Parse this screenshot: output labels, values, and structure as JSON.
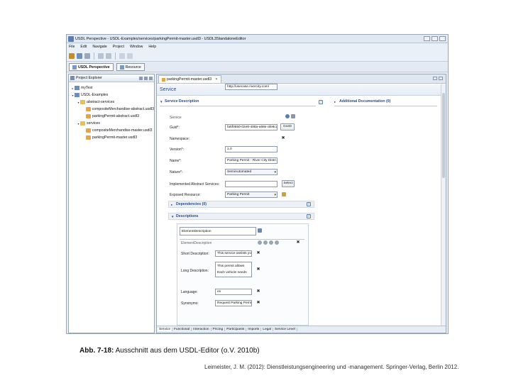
{
  "window": {
    "title": "USDL Perspective - USDL-Examples/services/parkingPermit-master.usdl3 - USDL3StandaloneEditor"
  },
  "menu": [
    "File",
    "Edit",
    "Navigate",
    "Project",
    "Window",
    "Help"
  ],
  "perspectives": {
    "active": "USDL Perspective",
    "other": "Resource"
  },
  "explorer": {
    "title": "Project Explorer",
    "tree": [
      {
        "label": "myTest",
        "level": 0,
        "kind": "project",
        "twisty": "▸"
      },
      {
        "label": "USDL-Examples",
        "level": 0,
        "kind": "project",
        "twisty": "▾"
      },
      {
        "label": "abstract-services",
        "level": 1,
        "kind": "folder",
        "twisty": "▾"
      },
      {
        "label": "compositeMerchandise-abstract.usdl3",
        "level": 2,
        "kind": "file",
        "twisty": ""
      },
      {
        "label": "parkingPermit-abstract.usdl3",
        "level": 2,
        "kind": "file",
        "twisty": ""
      },
      {
        "label": "services",
        "level": 1,
        "kind": "folder",
        "twisty": "▾"
      },
      {
        "label": "compositeMerchandise-master.usdl3",
        "level": 2,
        "kind": "file",
        "twisty": ""
      },
      {
        "label": "parkingPermit-master.usdl3",
        "level": 2,
        "kind": "file",
        "twisty": ""
      }
    ]
  },
  "editor": {
    "tab": "parkingPermit-master.usdl3",
    "form_title": "Service",
    "service_description": {
      "title": "Service Description",
      "service_label": "Service",
      "fields": {
        "guid_label": "Guid*:",
        "guid_value": "fa5f0650-02e8-488a-a68e-afe8cd",
        "guid_button": "GUID",
        "namespace_label": "Namespace:",
        "namespace_value": "http://usecase.rivercity.com/",
        "version_label": "Version*:",
        "version_value": "1.0",
        "name_label": "Name*:",
        "name_value": "Parking Permit - River City Distri",
        "nature_label": "Nature*:",
        "nature_value": "SemiAutomated",
        "implemented_label": "Implemented Abstract Services:",
        "implemented_value": "",
        "select_button": "Select",
        "exposed_label": "Exposed Resource:",
        "exposed_value": "Parking Permit"
      }
    },
    "additional_documentation": {
      "title": "Additional Documentation (0)"
    },
    "dependencies": {
      "title": "Dependencies (0)"
    },
    "descriptions": {
      "title": "Descriptions",
      "list_item": "ElementDescription",
      "detail_title": "ElementDescription",
      "short_label": "Short Description:",
      "short_value": "This service assists you",
      "long_label": "Long Description:",
      "long_value_1": "This permit allows",
      "long_value_2": "Each vehicle needs",
      "language_label": "Language:",
      "language_value": "en",
      "synonyms_label": "Synonyms:",
      "synonyms_value": "Request Parking Permi"
    },
    "bottom_tabs": [
      "Service",
      "Functional",
      "Interaction",
      "Pricing",
      "Participants",
      "Imports",
      "Legal",
      "Service Level"
    ],
    "active_bottom_tab": "Service"
  },
  "caption": {
    "label": "Abb. 7-18:",
    "text": " Ausschnitt aus dem USDL-Editor (o.V. 2010b)"
  },
  "citation": "Leimeister, J. M. (2012): Dienstleistungsengineering und -management. Springer-Verlag, Berlin 2012.",
  "colors": {
    "accent": "#2a4e8e",
    "folder": "#e7bf55",
    "file": "#e8a24a"
  }
}
